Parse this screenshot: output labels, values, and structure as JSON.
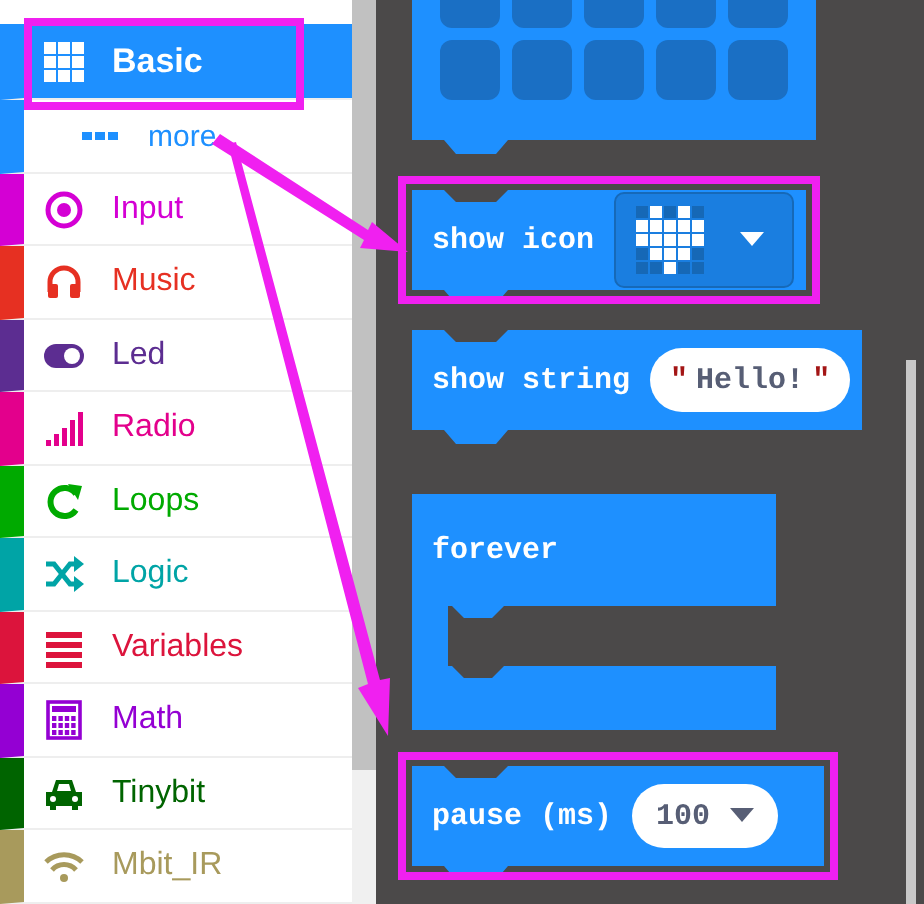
{
  "categories": [
    {
      "kind": "basic",
      "label": "Basic",
      "color": "#1e90ff",
      "selected": true,
      "highlighted": true
    },
    {
      "kind": "more",
      "label": "more",
      "color": "#1e90ff",
      "selected": false,
      "highlighted": false
    },
    {
      "kind": "input",
      "label": "Input",
      "color": "#d400d4",
      "selected": false,
      "highlighted": false
    },
    {
      "kind": "music",
      "label": "Music",
      "color": "#e63022",
      "selected": false,
      "highlighted": false
    },
    {
      "kind": "led",
      "label": "Led",
      "color": "#5c2d91",
      "selected": false,
      "highlighted": false
    },
    {
      "kind": "radio",
      "label": "Radio",
      "color": "#e3008c",
      "selected": false,
      "highlighted": false
    },
    {
      "kind": "loops",
      "label": "Loops",
      "color": "#00aa00",
      "selected": false,
      "highlighted": false
    },
    {
      "kind": "logic",
      "label": "Logic",
      "color": "#00a4a6",
      "selected": false,
      "highlighted": false
    },
    {
      "kind": "variables",
      "label": "Variables",
      "color": "#dc143c",
      "selected": false,
      "highlighted": false
    },
    {
      "kind": "math",
      "label": "Math",
      "color": "#9400d3",
      "selected": false,
      "highlighted": false
    },
    {
      "kind": "car",
      "label": "Tinybit",
      "color": "#006400",
      "selected": false,
      "highlighted": false
    },
    {
      "kind": "wireless",
      "label": "Mbit_IR",
      "color": "#a89a5c",
      "selected": false,
      "highlighted": false
    }
  ],
  "blocks": [
    {
      "kind": "leds",
      "leds": [
        [
          false,
          false,
          false,
          false,
          false
        ],
        [
          false,
          false,
          false,
          false,
          false
        ]
      ],
      "highlighted": false
    },
    {
      "kind": "show_icon",
      "label": "show icon",
      "icon_leds": [
        [
          false,
          true,
          false,
          true,
          false
        ],
        [
          true,
          true,
          true,
          true,
          true
        ],
        [
          true,
          true,
          true,
          true,
          true
        ],
        [
          false,
          true,
          true,
          true,
          false
        ],
        [
          false,
          false,
          true,
          false,
          false
        ]
      ],
      "highlighted": true
    },
    {
      "kind": "show_string",
      "label": "show string",
      "open_quote": "\"",
      "text": "Hello!",
      "close_quote": "\"",
      "highlighted": false
    },
    {
      "kind": "forever",
      "label": "forever",
      "highlighted": false
    },
    {
      "kind": "pause",
      "label": "pause (ms)",
      "value": "100",
      "highlighted": true
    }
  ]
}
